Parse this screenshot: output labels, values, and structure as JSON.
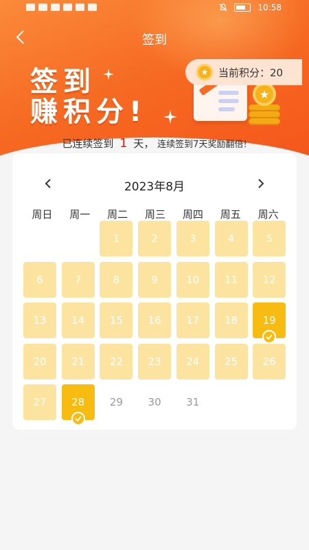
{
  "status_bar": {
    "time": "10:58"
  },
  "nav": {
    "title": "签到",
    "back_icon": "chevron-left-icon"
  },
  "banner": {
    "line1": "签到",
    "line2": "赚积分!"
  },
  "points": {
    "label": "当前积分：20"
  },
  "streak": {
    "prefix": "已连续签到",
    "days": "1",
    "suffix": "天，",
    "note": "连续签到7天奖励翻倍!"
  },
  "calendar": {
    "month_title": "2023年8月",
    "weekdays": [
      "周日",
      "周一",
      "周二",
      "周三",
      "周四",
      "周五",
      "周六"
    ],
    "days": [
      {
        "day": "1",
        "state": "month"
      },
      {
        "day": "2",
        "state": "month"
      },
      {
        "day": "3",
        "state": "month"
      },
      {
        "day": "4",
        "state": "month"
      },
      {
        "day": "5",
        "state": "month"
      },
      {
        "day": "6",
        "state": "month"
      },
      {
        "day": "7",
        "state": "month"
      },
      {
        "day": "8",
        "state": "month"
      },
      {
        "day": "9",
        "state": "month"
      },
      {
        "day": "10",
        "state": "month"
      },
      {
        "day": "11",
        "state": "month"
      },
      {
        "day": "12",
        "state": "month"
      },
      {
        "day": "13",
        "state": "month"
      },
      {
        "day": "14",
        "state": "month"
      },
      {
        "day": "15",
        "state": "month"
      },
      {
        "day": "16",
        "state": "month"
      },
      {
        "day": "17",
        "state": "month"
      },
      {
        "day": "18",
        "state": "month"
      },
      {
        "day": "19",
        "state": "signed"
      },
      {
        "day": "20",
        "state": "month"
      },
      {
        "day": "21",
        "state": "month"
      },
      {
        "day": "22",
        "state": "month"
      },
      {
        "day": "23",
        "state": "month"
      },
      {
        "day": "24",
        "state": "month"
      },
      {
        "day": "25",
        "state": "month"
      },
      {
        "day": "26",
        "state": "month"
      },
      {
        "day": "27",
        "state": "month"
      },
      {
        "day": "28",
        "state": "signed"
      },
      {
        "day": "29",
        "state": "future"
      },
      {
        "day": "30",
        "state": "future"
      },
      {
        "day": "31",
        "state": "future"
      }
    ],
    "first_weekday": 2
  },
  "colors": {
    "header_orange": "#f66a22",
    "cell_light": "#fde3a0",
    "cell_signed": "#f8bb12",
    "streak_number": "#f02020"
  }
}
